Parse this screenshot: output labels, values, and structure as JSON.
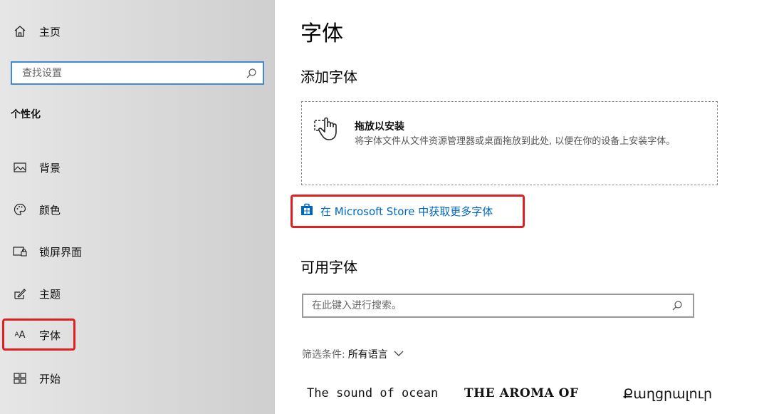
{
  "sidebar": {
    "home_label": "主页",
    "search_placeholder": "查找设置",
    "section_header": "个性化",
    "items": [
      {
        "label": "背景",
        "icon": "image-icon"
      },
      {
        "label": "颜色",
        "icon": "palette-icon"
      },
      {
        "label": "锁屏界面",
        "icon": "lock-screen-icon"
      },
      {
        "label": "主题",
        "icon": "theme-brush-icon"
      },
      {
        "label": "字体",
        "icon": "font-icon"
      },
      {
        "label": "开始",
        "icon": "start-grid-icon"
      }
    ]
  },
  "main": {
    "title": "字体",
    "add_heading": "添加字体",
    "drop_title": "拖放以安装",
    "drop_desc": "将字体文件从文件资源管理器或桌面拖放到此处, 以便在你的设备上安装字体。",
    "store_link": "在 Microsoft Store 中获取更多字体",
    "available_heading": "可用字体",
    "font_search_placeholder": "在此键入进行搜索。",
    "filter_label": "筛选条件:",
    "filter_value": "所有语言",
    "previews": [
      "The sound of ocean",
      "THE AROMA OF",
      "Քաղցրալուր"
    ]
  },
  "colors": {
    "accent": "#0067c0",
    "search_border": "#3f8ad4",
    "highlight": "#e02020"
  }
}
